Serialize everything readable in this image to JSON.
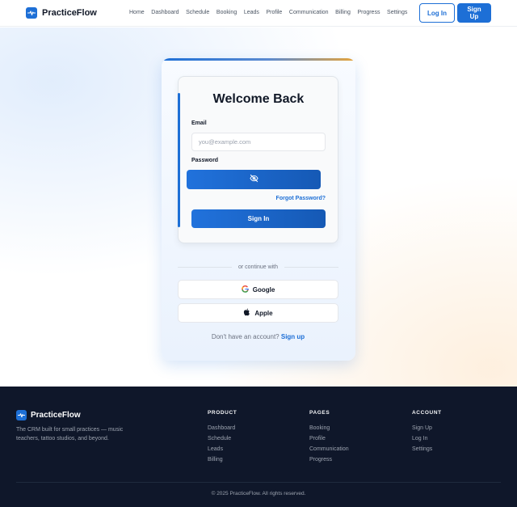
{
  "nav": {
    "brand": "PracticeFlow",
    "links": [
      "Home",
      "Dashboard",
      "Schedule",
      "Booking",
      "Leads",
      "Profile",
      "Communication",
      "Billing",
      "Progress",
      "Settings"
    ],
    "login_label": "Log In",
    "signup_label": "Sign Up"
  },
  "login": {
    "title": "Welcome Back",
    "email_label": "Email",
    "email_placeholder": "you@example.com",
    "password_label": "Password",
    "forgot": "Forgot Password?",
    "submit": "Sign In",
    "divider": "or continue with",
    "google": "Google",
    "apple": "Apple",
    "no_account": "Don't have an account?",
    "signup_link": "Sign up"
  },
  "footer": {
    "brand": "PracticeFlow",
    "tagline": "The CRM built for small practices — music teachers, tattoo studios, and beyond.",
    "columns": [
      {
        "heading": "PRODUCT",
        "items": [
          "Dashboard",
          "Schedule",
          "Leads",
          "Billing"
        ]
      },
      {
        "heading": "PAGES",
        "items": [
          "Booking",
          "Profile",
          "Communication",
          "Progress"
        ]
      },
      {
        "heading": "ACCOUNT",
        "items": [
          "Sign Up",
          "Log In",
          "Settings"
        ]
      }
    ],
    "copyright": "© 2025 PracticeFlow. All rights reserved."
  },
  "colors": {
    "accent": "#1d6fd6",
    "footer_bg": "#0f172a",
    "highlight": "#e7a43a"
  },
  "icons": {
    "brand": "pulse-icon",
    "password_toggle": "eye-off-icon",
    "google": "google-icon",
    "apple": "apple-icon"
  }
}
